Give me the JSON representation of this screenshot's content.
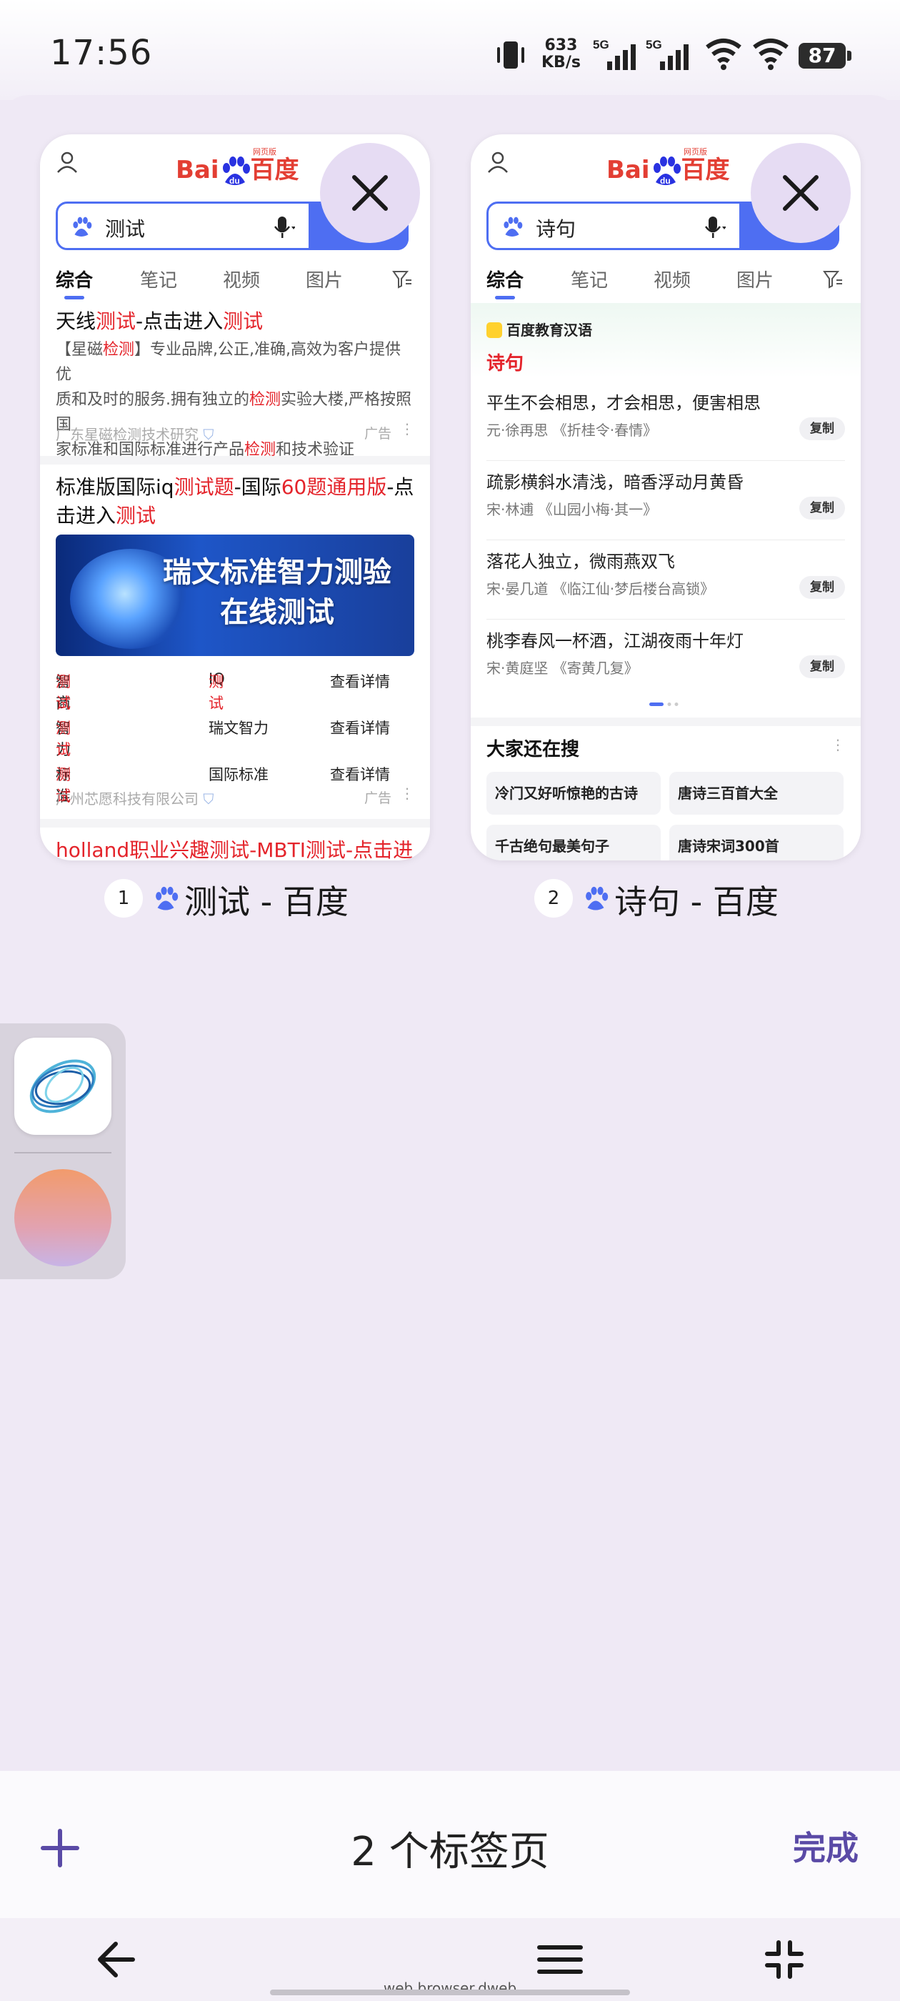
{
  "status_bar": {
    "time": "17:56",
    "net_speed_value": "633",
    "net_speed_unit": "KB/s",
    "signal1_label": "5G",
    "signal2_label": "5G",
    "battery": "87"
  },
  "tabs": [
    {
      "index": "1",
      "title": "测试 - 百度",
      "preview": {
        "logo_small": "网页版",
        "query": "测试",
        "filters": [
          "综合",
          "笔记",
          "视频",
          "图片"
        ],
        "results": [
          {
            "title_parts": [
              "天线",
              "测试",
              "-点击进入",
              "测试"
            ],
            "desc_lines": [
              "【星磁",
              "检测",
              "】专业品牌,公正,准确,高效为客户提供优",
              "质和及时的服务.拥有独立的",
              "检测",
              "实验大楼,严格按照国",
              "家标准和国际标准进行产品",
              "检测",
              "和技术验证"
            ],
            "source": "广东星磁检测技术研究",
            "ad": "广告"
          },
          {
            "title_line1": [
              "标准版国际iq",
              "测试题",
              "-国际",
              "60题通用版",
              "-点"
            ],
            "title_line2": [
              "击进入",
              "测试"
            ],
            "banner_line1": "瑞文标准智力测验",
            "banner_line2": "在线测试",
            "grid": [
              [
                "智商",
                "测试",
                "IQ",
                "测试",
                "查看详情"
              ],
              [
                "智力",
                "测试",
                "瑞文智力",
                "",
                "查看详情"
              ],
              [
                "标准",
                "测试",
                "国际标准",
                "",
                "查看详情"
              ]
            ],
            "source": "广州芯愿科技有限公司",
            "ad": "广告"
          },
          {
            "title_parts": [
              "holland职业兴趣",
              "测试",
              "-MBTI",
              "测试",
              "-点击进"
            ]
          }
        ]
      }
    },
    {
      "index": "2",
      "title": "诗句 - 百度",
      "preview": {
        "logo_small": "网页版",
        "query": "诗句",
        "filters": [
          "综合",
          "笔记",
          "视频",
          "图片"
        ],
        "edu_badge": "百度教育汉语",
        "edu_title": "诗句",
        "poems": [
          {
            "line": "平生不会相思，才会相思，便害相思",
            "author": "元·徐再思  《折桂令·春情》",
            "copy": "复制"
          },
          {
            "line": "疏影横斜水清浅，暗香浮动月黄昏",
            "author": "宋·林逋  《山园小梅·其一》",
            "copy": "复制"
          },
          {
            "line": "落花人独立，微雨燕双飞",
            "author": "宋·晏几道  《临江仙·梦后楼台高锁》",
            "copy": "复制"
          },
          {
            "line": "桃李春风一杯酒，江湖夜雨十年灯",
            "author": "宋·黄庭坚  《寄黄几复》",
            "copy": "复制"
          }
        ],
        "also_search_title": "大家还在搜",
        "also_search": [
          "冷门又好听惊艳的古诗",
          "唐诗三百首大全",
          "千古绝句最美句子",
          "唐诗宋词300首"
        ]
      }
    }
  ],
  "bottom_bar": {
    "tab_count": "2 个标签页",
    "done": "完成"
  },
  "nav": {
    "url_hint": "web.browser.dweb"
  },
  "colors": {
    "accent": "#5a4aa6",
    "baidu_blue": "#4e6ef2",
    "baidu_red": "#e33e33",
    "highlight_red": "#e4242b",
    "background": "#efe9f5"
  }
}
